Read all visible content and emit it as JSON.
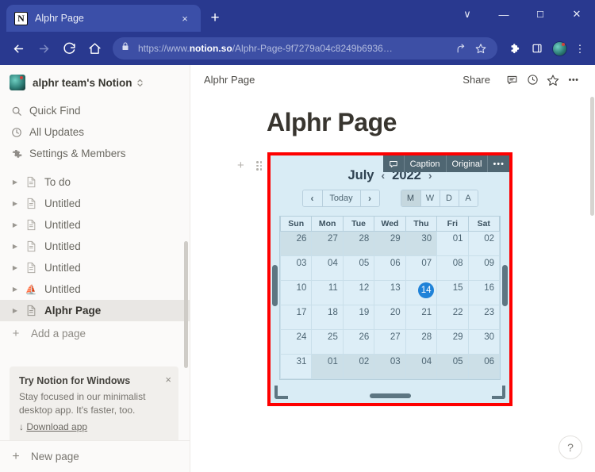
{
  "browser": {
    "tab": {
      "title": "Alphr Page",
      "favicon": "notion-icon",
      "close_label": "×"
    },
    "new_tab_label": "+",
    "window_controls": [
      {
        "name": "chevron-down-icon",
        "glyph": "∨"
      },
      {
        "name": "minimize-icon",
        "glyph": "—"
      },
      {
        "name": "maximize-icon",
        "glyph": "☐"
      },
      {
        "name": "close-icon",
        "glyph": "✕"
      }
    ],
    "nav": {
      "back": "←",
      "forward": "→",
      "reload": "↻",
      "home": "⌂"
    },
    "omnibox": {
      "lock": "lock-icon",
      "scheme": "https://www.",
      "domain": "notion.so",
      "path": "/Alphr-Page-9f7279a04c8249b6936…",
      "full_url": "https://www.notion.so/Alphr-Page-9f7279a04c8249b6936…",
      "share_icon": "⤴",
      "bookmark_icon": "☆"
    },
    "extensions_icon": "✿",
    "sidepanel_icon": "▭",
    "profile_icon": "profile-avatar",
    "menu_icon": "⋮"
  },
  "sidebar": {
    "workspace": {
      "name": "alphr team's Notion",
      "avatar": "workspace-avatar"
    },
    "quick_items": [
      {
        "label": "Quick Find",
        "icon": "🔍",
        "icon_name": "search-icon"
      },
      {
        "label": "All Updates",
        "icon": "◴",
        "icon_name": "clock-icon"
      },
      {
        "label": "Settings & Members",
        "icon": "⚙",
        "icon_name": "gear-icon"
      }
    ],
    "pages": [
      {
        "label": "To do",
        "icon": "📄",
        "active": false
      },
      {
        "label": "Untitled",
        "icon": "📄",
        "active": false
      },
      {
        "label": "Untitled",
        "icon": "📄",
        "active": false
      },
      {
        "label": "Untitled",
        "icon": "📄",
        "active": false
      },
      {
        "label": "Untitled",
        "icon": "📄",
        "active": false
      },
      {
        "label": "Untitled",
        "icon": "⛵",
        "active": false
      },
      {
        "label": "Alphr Page",
        "icon": "📄",
        "active": true
      }
    ],
    "add_page_label": "Add a page",
    "promo": {
      "title": "Try Notion for Windows",
      "body": "Stay focused in our minimalist desktop app. It's faster, too.",
      "link": "Download app",
      "link_arrow": "↓",
      "close": "×"
    },
    "new_page_label": "New page"
  },
  "main": {
    "breadcrumb": "Alphr Page",
    "share_label": "Share",
    "topbar_icons": [
      {
        "name": "comment-icon",
        "glyph": "💬"
      },
      {
        "name": "updates-clock-icon",
        "glyph": "◴"
      },
      {
        "name": "favorite-star-icon",
        "glyph": "☆"
      },
      {
        "name": "more-options-icon",
        "glyph": "•••"
      }
    ],
    "page_title": "Alphr Page",
    "block_plus": "+",
    "block_drag": "drag-handle-icon"
  },
  "embed": {
    "toolbar": [
      {
        "name": "comment-icon",
        "label": "🗨"
      },
      {
        "name": "caption-button",
        "label": "Caption"
      },
      {
        "name": "original-button",
        "label": "Original"
      },
      {
        "name": "more-menu-button",
        "label": "•••"
      }
    ],
    "border_color": "#fe0000",
    "background": "#d9ecf5"
  },
  "calendar": {
    "month": "July",
    "year": "2022",
    "prev_year_arrow": "‹",
    "next_year_arrow": "›",
    "nav": {
      "prev": "‹",
      "today": "Today",
      "next": "›"
    },
    "views": [
      {
        "label": "M",
        "selected": true
      },
      {
        "label": "W",
        "selected": false
      },
      {
        "label": "D",
        "selected": false
      },
      {
        "label": "A",
        "selected": false
      }
    ],
    "weekdays": [
      "Sun",
      "Mon",
      "Tue",
      "Wed",
      "Thu",
      "Fri",
      "Sat"
    ],
    "today_value": "14",
    "today_color": "#1f82d8",
    "weeks": [
      [
        {
          "d": "26",
          "other": true
        },
        {
          "d": "27",
          "other": true
        },
        {
          "d": "28",
          "other": true
        },
        {
          "d": "29",
          "other": true
        },
        {
          "d": "30",
          "other": true
        },
        {
          "d": "01",
          "other": false
        },
        {
          "d": "02",
          "other": false
        }
      ],
      [
        {
          "d": "03",
          "other": false
        },
        {
          "d": "04",
          "other": false
        },
        {
          "d": "05",
          "other": false
        },
        {
          "d": "06",
          "other": false
        },
        {
          "d": "07",
          "other": false
        },
        {
          "d": "08",
          "other": false
        },
        {
          "d": "09",
          "other": false
        }
      ],
      [
        {
          "d": "10",
          "other": false
        },
        {
          "d": "11",
          "other": false
        },
        {
          "d": "12",
          "other": false
        },
        {
          "d": "13",
          "other": false
        },
        {
          "d": "14",
          "other": false,
          "today": true
        },
        {
          "d": "15",
          "other": false
        },
        {
          "d": "16",
          "other": false
        }
      ],
      [
        {
          "d": "17",
          "other": false
        },
        {
          "d": "18",
          "other": false
        },
        {
          "d": "19",
          "other": false
        },
        {
          "d": "20",
          "other": false
        },
        {
          "d": "21",
          "other": false
        },
        {
          "d": "22",
          "other": false
        },
        {
          "d": "23",
          "other": false
        }
      ],
      [
        {
          "d": "24",
          "other": false
        },
        {
          "d": "25",
          "other": false
        },
        {
          "d": "26",
          "other": false
        },
        {
          "d": "27",
          "other": false
        },
        {
          "d": "28",
          "other": false
        },
        {
          "d": "29",
          "other": false
        },
        {
          "d": "30",
          "other": false
        }
      ],
      [
        {
          "d": "31",
          "other": false
        },
        {
          "d": "01",
          "other": true
        },
        {
          "d": "02",
          "other": true
        },
        {
          "d": "03",
          "other": true
        },
        {
          "d": "04",
          "other": true
        },
        {
          "d": "05",
          "other": true
        },
        {
          "d": "06",
          "other": true
        }
      ]
    ]
  },
  "help": {
    "label": "?"
  }
}
